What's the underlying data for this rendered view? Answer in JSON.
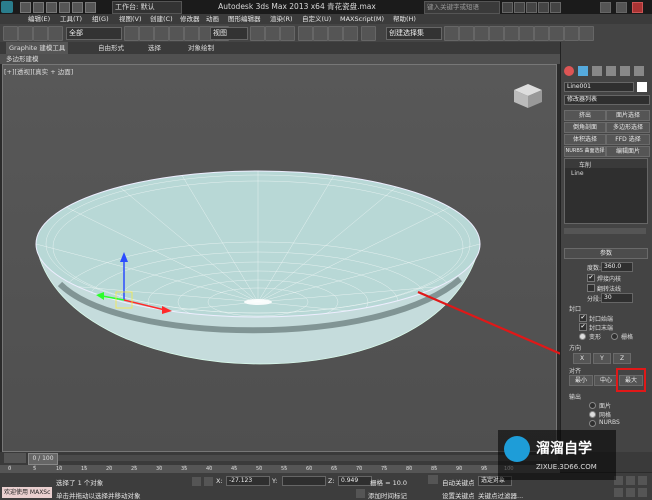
{
  "titlebar": {
    "workspace": "工作台: 默认",
    "title": "Autodesk 3ds Max  2013 x64      青花瓷盘.max",
    "search_placeholder": "键入关键字或短语"
  },
  "menu": [
    "编辑(E)",
    "工具(T)",
    "组(G)",
    "视图(V)",
    "创建(C)",
    "修改器",
    "动画",
    "图形编辑器",
    "渲染(R)",
    "自定义(U)",
    "MAXScript(M)",
    "帮助(H)"
  ],
  "toolbar": {
    "selection_filter": "全部",
    "ref_coord": "视图",
    "named_sel": "创建选择集"
  },
  "ribbon": {
    "tabs": [
      "Graphite 建模工具",
      "自由形式",
      "选择",
      "对象绘制"
    ],
    "subtab": "多边形建模"
  },
  "viewport": {
    "label": "[+][透视][真实 + 边面]"
  },
  "command_panel": {
    "object_name": "Line001",
    "modifier_list": "修改器列表",
    "buttons": [
      "挤出",
      "面片选择",
      "倒角剖面",
      "多边形选择",
      "体积选择",
      "FFD 选择",
      "NURBS 曲面选择",
      "编辑面片"
    ],
    "stack": [
      "车削",
      "Line"
    ],
    "rollout_title": "参数",
    "degrees_label": "度数:",
    "degrees_value": "360.0",
    "weld_core": "焊接内核",
    "flip_normals": "翻转法线",
    "segments_label": "分段:",
    "segments_value": "30",
    "capping_title": "封口",
    "cap_start": "封口始端",
    "cap_end": "封口末端",
    "morph": "变形",
    "grid": "栅格",
    "direction_title": "方向",
    "dir_x": "X",
    "dir_y": "Y",
    "dir_z": "Z",
    "align_title": "对齐",
    "align_min": "最小",
    "align_center": "中心",
    "align_max": "最大",
    "output_title": "输出",
    "out_patch": "面片",
    "out_mesh": "网格",
    "out_nurbs": "NURBS"
  },
  "timeline": {
    "frame": "0 / 100",
    "ticks": [
      "0",
      "5",
      "10",
      "15",
      "20",
      "25",
      "30",
      "35",
      "40",
      "45",
      "50",
      "55",
      "60",
      "65",
      "70",
      "75",
      "80",
      "85",
      "90",
      "95",
      "100"
    ]
  },
  "status": {
    "welcome": "欢迎使用 MAXSc",
    "selected": "选择了 1 个对象",
    "prompt": "单击并拖动以选择并移动对象",
    "x_label": "X:",
    "x": "-27.123",
    "y_label": "Y:",
    "z_label": "Z:",
    "z": "0.949",
    "grid": "栅格 = 10.0",
    "auto_key": "自动关键点",
    "selected_obj": "选定对象",
    "set_key": "设置关键点",
    "key_filter": "关键点过滤器...",
    "add_time_tag": "添加时间标记"
  },
  "watermark": {
    "brand": "溜溜自学",
    "site": "ZIXUE.3D66.COM"
  }
}
